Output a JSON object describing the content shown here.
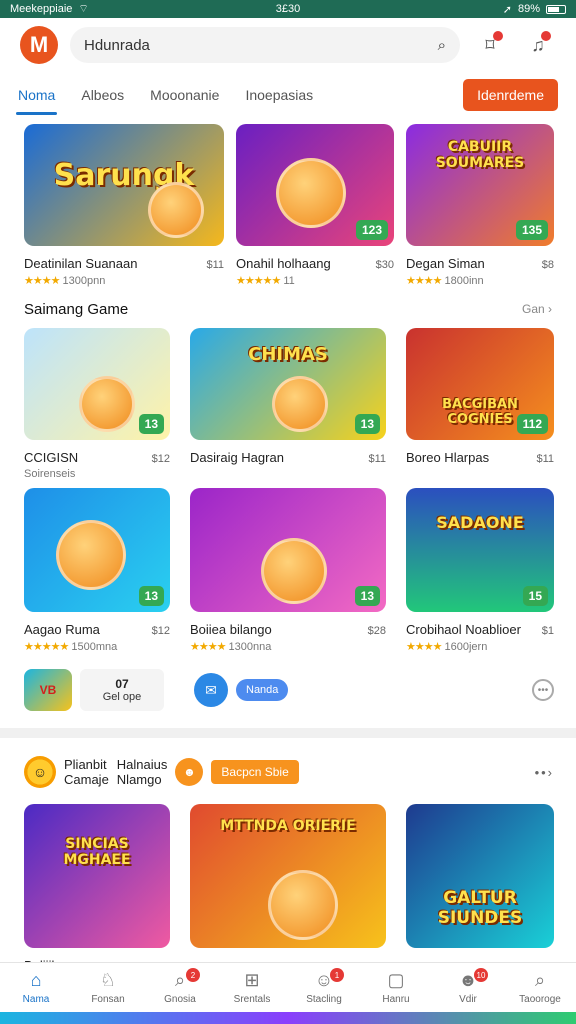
{
  "status": {
    "carrier": "Meekeppiaie",
    "time": "3£30",
    "battery": "89%"
  },
  "header": {
    "logo": "M",
    "search_text": "Hdunrada"
  },
  "tabs": [
    {
      "label": "Noma"
    },
    {
      "label": "Albeos"
    },
    {
      "label": "Mooonanie"
    },
    {
      "label": "Inoepasias"
    }
  ],
  "cta_label": "Idenrdeme",
  "featured": [
    {
      "title": "Sarungk",
      "name": "Deatinilan Suanaan",
      "price": "$11",
      "sub": "1300pnn",
      "stars": "★★★★",
      "rating": "",
      "colors": [
        "#1a6bd6",
        "#f5b81c"
      ]
    },
    {
      "title": "",
      "name": "Onahil holhaang",
      "price": "$30",
      "sub": "11",
      "stars": "★★★★★",
      "rating": "123",
      "colors": [
        "#6a1fc2",
        "#e9447a"
      ]
    },
    {
      "title": "CABUIIR SOUMARES",
      "name": "Degan Siman",
      "price": "$8",
      "sub": "1800inn",
      "stars": "★★★★",
      "rating": "135",
      "colors": [
        "#8a2be2",
        "#f07c2b"
      ]
    }
  ],
  "section1": {
    "title": "Saimang Game",
    "more": "Gan ›"
  },
  "row2": [
    {
      "title": "",
      "name": "CCIGISN",
      "sub": "Soirenseis",
      "price": "$12",
      "rating": "13",
      "colors": [
        "#bde3fb",
        "#fff3a8"
      ]
    },
    {
      "title": "CHIMAS",
      "name": "Dasiraig Hagran",
      "sub": "",
      "price": "$11",
      "rating": "13",
      "colors": [
        "#29a9e8",
        "#f7d21b"
      ]
    },
    {
      "title": "BACGIBAN COGNIES",
      "name": "Boreo Hlarpas",
      "sub": "",
      "price": "$11",
      "rating": "112",
      "colors": [
        "#c9322f",
        "#f58f1e"
      ]
    }
  ],
  "row3": [
    {
      "title": "",
      "name": "Aagao Ruma",
      "price": "$12",
      "sub": "1500mna",
      "stars": "★★★★★",
      "rating": "13",
      "colors": [
        "#1e8fe8",
        "#2ad0f0"
      ]
    },
    {
      "title": "",
      "name": "Boiiea bilango",
      "price": "$28",
      "sub": "1300nna",
      "stars": "★★★★",
      "rating": "13",
      "colors": [
        "#9b25c9",
        "#f36ac3"
      ]
    },
    {
      "title": "SADAONE",
      "name": "Crobihaol Noablioer",
      "price": "$1",
      "sub": "1600jern",
      "stars": "★★★★",
      "rating": "15",
      "colors": [
        "#2b4fbf",
        "#22c77a"
      ]
    }
  ],
  "mini": {
    "tile": "VB",
    "strip_top": "07",
    "strip_bottom": "Gel ope",
    "pill": "Nanda"
  },
  "promo": {
    "line1": "Plianbit",
    "line2": "Camaje",
    "line3": "Halnaius",
    "line4": "Nlamgo",
    "tag": "Bacpcn Sbie"
  },
  "row4": [
    {
      "title": "SINCIAS MGHAEE",
      "name": "Boljiibrnas",
      "colors": [
        "#4b2ac4",
        "#f05aa1"
      ]
    },
    {
      "title": "MTTNDA ORIERIE",
      "name": "",
      "colors": [
        "#e04a2f",
        "#f7c21b"
      ]
    },
    {
      "title": "GALTUR SIUNDES",
      "name": "",
      "colors": [
        "#1e3a8f",
        "#1ad0d7"
      ]
    }
  ],
  "nav": [
    {
      "label": "Nama",
      "icon": "home-icon",
      "glyph": "⌂",
      "badge": ""
    },
    {
      "label": "Fonsan",
      "icon": "apps-icon",
      "glyph": "♘",
      "badge": ""
    },
    {
      "label": "Gnosia",
      "icon": "search-icon",
      "glyph": "⌕",
      "badge": "2"
    },
    {
      "label": "Srentals",
      "icon": "grid-icon",
      "glyph": "⊞",
      "badge": ""
    },
    {
      "label": "Stacling",
      "icon": "people-icon",
      "glyph": "☺",
      "badge": "1"
    },
    {
      "label": "Hanru",
      "icon": "chat-icon",
      "glyph": "▢",
      "badge": ""
    },
    {
      "label": "Vdir",
      "icon": "face-icon",
      "glyph": "☻",
      "badge": "10"
    },
    {
      "label": "Taooroge",
      "icon": "magnify-icon",
      "glyph": "⌕",
      "badge": ""
    }
  ]
}
